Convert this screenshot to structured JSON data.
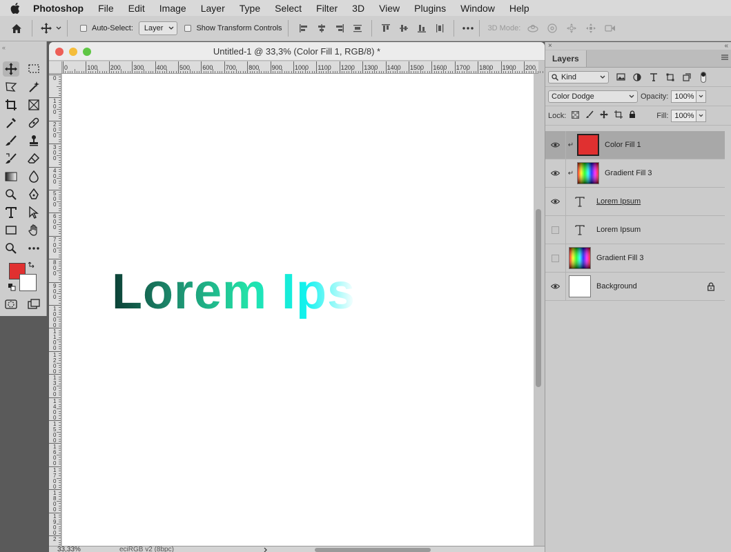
{
  "menubar": {
    "app_name": "Photoshop",
    "items": [
      "File",
      "Edit",
      "Image",
      "Layer",
      "Type",
      "Select",
      "Filter",
      "3D",
      "View",
      "Plugins",
      "Window",
      "Help"
    ]
  },
  "options": {
    "auto_select_label": "Auto-Select:",
    "auto_select_target": "Layer",
    "transform_controls_label": "Show Transform Controls",
    "mode_3d_label": "3D Mode:"
  },
  "document": {
    "title": "Untitled-1 @ 33,3% (Color Fill 1, RGB/8) *",
    "canvas_text": "Lorem Ips",
    "zoom": "33,33%",
    "profile": "eciRGB v2 (8bpc)",
    "ruler_h": [
      "0",
      "100",
      "200",
      "300",
      "400",
      "500",
      "600",
      "700",
      "800",
      "900",
      "1000",
      "1100",
      "1200",
      "1300",
      "1400",
      "1500",
      "1600",
      "1700",
      "1800",
      "1900",
      "200"
    ],
    "ruler_v": [
      "0",
      "1 0 0",
      "2 0 0",
      "3 0 0",
      "4 0 0",
      "5 0 0",
      "6 0 0",
      "7 0 0",
      "8 0 0",
      "9 0 0",
      "1 0 0 0",
      "1 1 0 0",
      "1 2 0 0",
      "1 3 0 0",
      "1 4 0 0",
      "1 5 0 0",
      "1 6 0 0",
      "1 7 0 0",
      "1 8 0 0",
      "1 9 0 0",
      "2"
    ]
  },
  "layers_panel": {
    "tab": "Layers",
    "filter_kind": "Kind",
    "blend_mode": "Color Dodge",
    "opacity_label": "Opacity:",
    "opacity_value": "100%",
    "lock_label": "Lock:",
    "fill_label": "Fill:",
    "fill_value": "100%",
    "layers": [
      {
        "name": "Color Fill 1",
        "visible": true,
        "selected": true,
        "clipped": true,
        "thumb": "red"
      },
      {
        "name": "Gradient Fill 3",
        "visible": true,
        "selected": false,
        "clipped": true,
        "thumb": "gradient"
      },
      {
        "name": "Lorem Ipsum",
        "visible": true,
        "selected": false,
        "clipped": false,
        "thumb": "text"
      },
      {
        "name": "Lorem Ipsum",
        "visible": false,
        "selected": false,
        "clipped": false,
        "thumb": "text"
      },
      {
        "name": "Gradient Fill 3",
        "visible": false,
        "selected": false,
        "clipped": false,
        "thumb": "gradient"
      },
      {
        "name": "Background",
        "visible": true,
        "selected": false,
        "clipped": false,
        "thumb": "white",
        "locked": true
      }
    ]
  },
  "colors": {
    "foreground": "#e03030",
    "background": "#ffffff"
  }
}
